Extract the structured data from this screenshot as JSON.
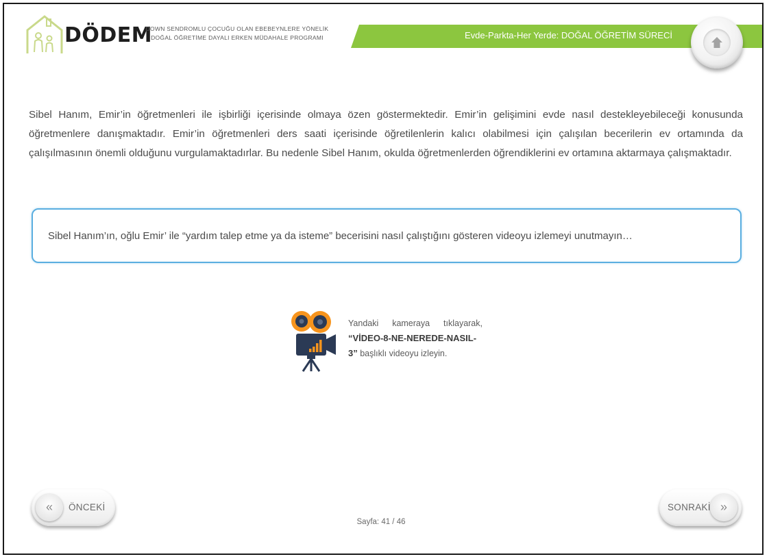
{
  "header": {
    "brand": "DÖDEM",
    "subtitle_line1": "DOWN SENDROMLU ÇOCUĞU OLAN EBEBEYNLERE YÖNELİK",
    "subtitle_line2": "DOĞAL ÖĞRETİME DAYALI ERKEN MÜDAHALE PROGRAMI",
    "section_title": "Evde-Parkta-Her Yerde: DOĞAL ÖĞRETİM SÜRECİ",
    "home_icon": "home-icon"
  },
  "content": {
    "paragraph": "Sibel Hanım, Emir’in öğretmenleri ile işbirliği içerisinde olmaya özen göstermektedir. Emir’in gelişimini evde nasıl destekleyebileceği konusunda öğretmenlere danışmaktadır. Emir’in öğretmenleri ders saati içerisinde öğretilenlerin kalıcı olabilmesi için çalışılan becerilerin ev ortamında da çalışılmasının önemli olduğunu vurgulamaktadırlar. Bu nedenle Sibel Hanım, okulda öğretmenlerden öğrendiklerini ev ortamına aktarmaya çalışmaktadır.",
    "callout": "Sibel Hanım’ın, oğlu Emir’ ile “yardım talep etme ya da isteme” becerisini nasıl çalıştığını gösteren videoyu izlemeyi unutmayın…"
  },
  "video": {
    "icon": "video-camera-icon",
    "caption_w1": "Yandaki",
    "caption_w2": "kameraya",
    "caption_w3": "tıklayarak,",
    "title_line1": "“VİDEO-8-NE-NEREDE-NASIL-",
    "title_line2": "3”",
    "caption_end": " başlıklı videoyu izleyin."
  },
  "navigation": {
    "prev_label": "ÖNCEKİ",
    "next_label": "SONRAKİ",
    "prev_glyph": "«",
    "next_glyph": "»",
    "page": "Sayfa: 41 / 46"
  },
  "colors": {
    "accent_green": "#8cc63f",
    "callout_border": "#5aaee0",
    "camera_orange": "#f7941d",
    "camera_navy": "#2b3a55"
  }
}
